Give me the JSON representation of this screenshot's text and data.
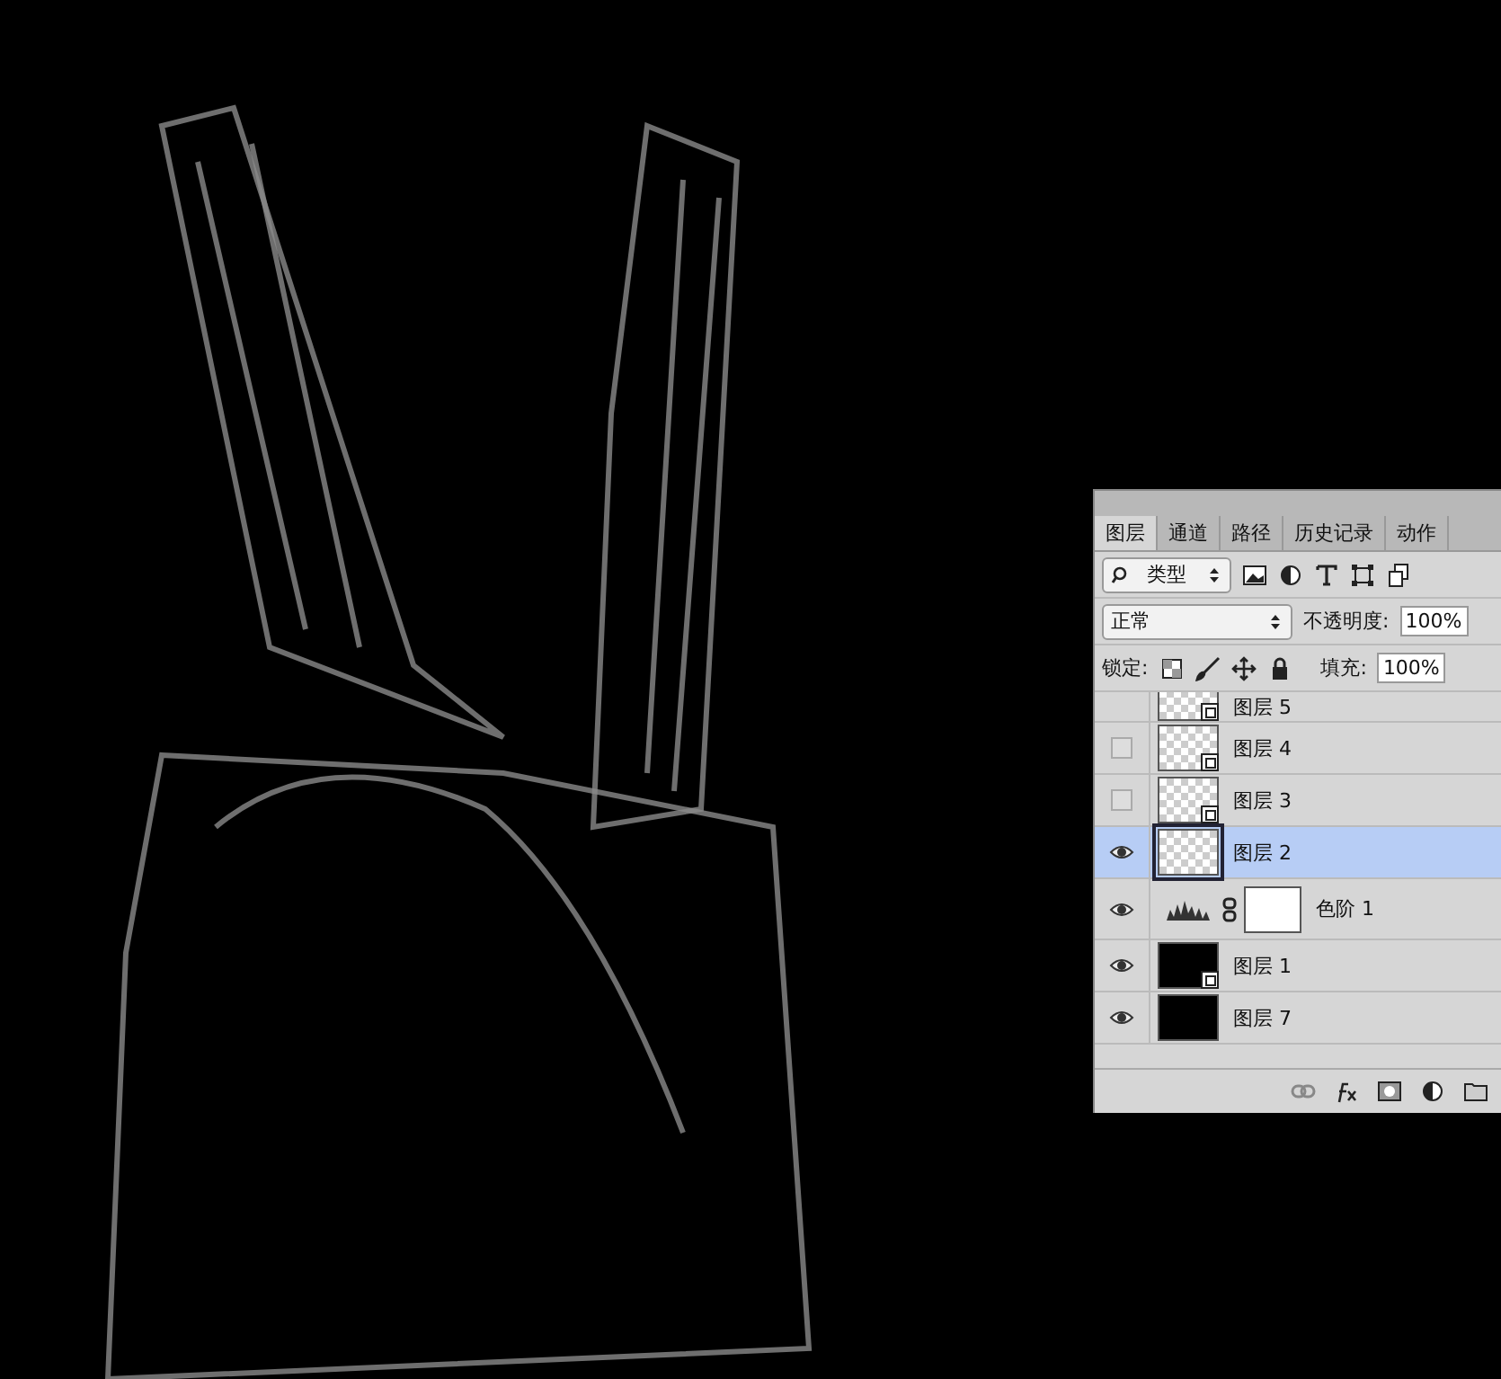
{
  "tabs": [
    {
      "label": "图层",
      "selected": true
    },
    {
      "label": "通道",
      "selected": false
    },
    {
      "label": "路径",
      "selected": false
    },
    {
      "label": "历史记录",
      "selected": false
    },
    {
      "label": "动作",
      "selected": false
    }
  ],
  "filter": {
    "value": "类型"
  },
  "blend_mode": {
    "value": "正常"
  },
  "opacity": {
    "label": "不透明度:",
    "value": "100%"
  },
  "lock": {
    "label": "锁定:"
  },
  "fill": {
    "label": "填充:",
    "value": "100%"
  },
  "layers": [
    {
      "name": "图层 5",
      "kind": "smart",
      "selected": false
    },
    {
      "name": "图层 4",
      "kind": "smart",
      "visible": false,
      "selected": false
    },
    {
      "name": "图层 3",
      "kind": "smart",
      "visible": false,
      "selected": false
    },
    {
      "name": "图层 2",
      "kind": "pixel",
      "visible": true,
      "selected": true
    },
    {
      "name": "色阶 1",
      "kind": "adjustment",
      "visible": true,
      "selected": false
    },
    {
      "name": "图层 1",
      "kind": "smart-image",
      "visible": true,
      "selected": false
    },
    {
      "name": "图层 7",
      "kind": "solid",
      "visible": true,
      "selected": false
    }
  ]
}
